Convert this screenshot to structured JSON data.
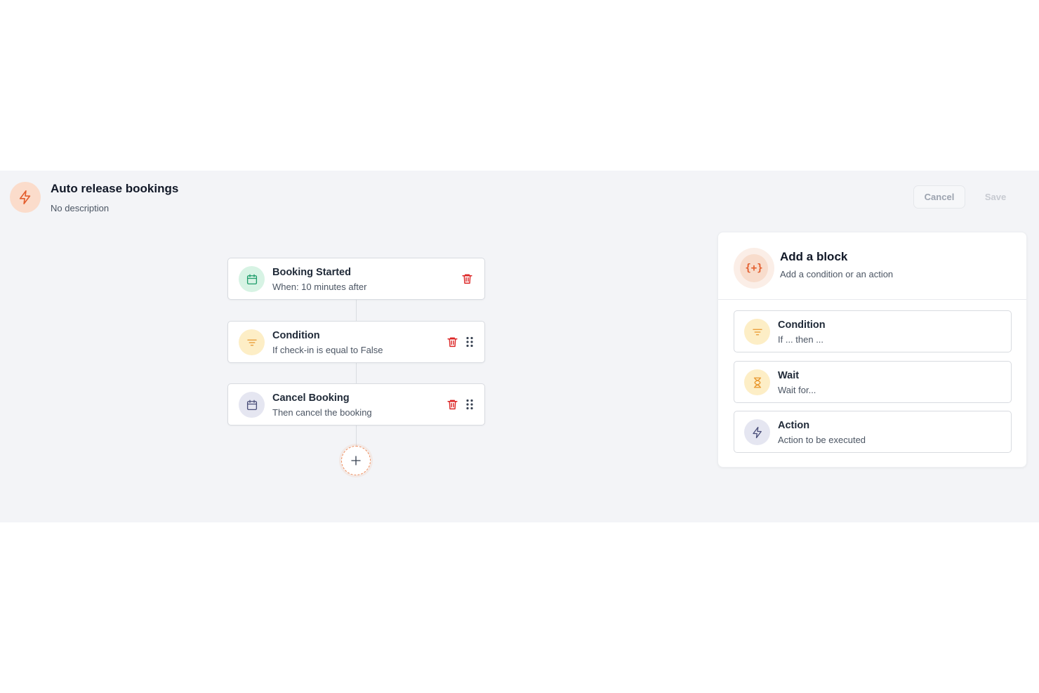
{
  "workflow": {
    "title": "Auto release bookings",
    "description": "No description",
    "icon": "lightning-icon"
  },
  "toolbar": {
    "cancel_label": "Cancel",
    "save_label": "Save"
  },
  "flow": {
    "nodes": [
      {
        "title": "Booking Started",
        "subtitle": "When: 10 minutes after",
        "icon": "calendar-icon",
        "color": "#1f9d6b"
      },
      {
        "title": "Condition",
        "subtitle": "If check-in is equal to False",
        "icon": "filter-icon",
        "color": "#e8962b"
      },
      {
        "title": "Cancel Booking",
        "subtitle": "Then cancel the booking",
        "icon": "calendar-icon",
        "color": "#4b4f7a"
      }
    ],
    "add_icon": "plus-icon"
  },
  "panel": {
    "title": "Add a block",
    "subtitle": "Add a condition or an action",
    "icon_glyph": "{+}",
    "options": [
      {
        "title": "Condition",
        "subtitle": "If ... then ...",
        "icon": "filter-icon"
      },
      {
        "title": "Wait",
        "subtitle": "Wait for...",
        "icon": "hourglass-icon"
      },
      {
        "title": "Action",
        "subtitle": "Action to be executed",
        "icon": "lightning-icon"
      }
    ]
  },
  "colors": {
    "accent": "#e35d2d",
    "danger": "#dc2626",
    "canvas": "#f3f4f7"
  }
}
